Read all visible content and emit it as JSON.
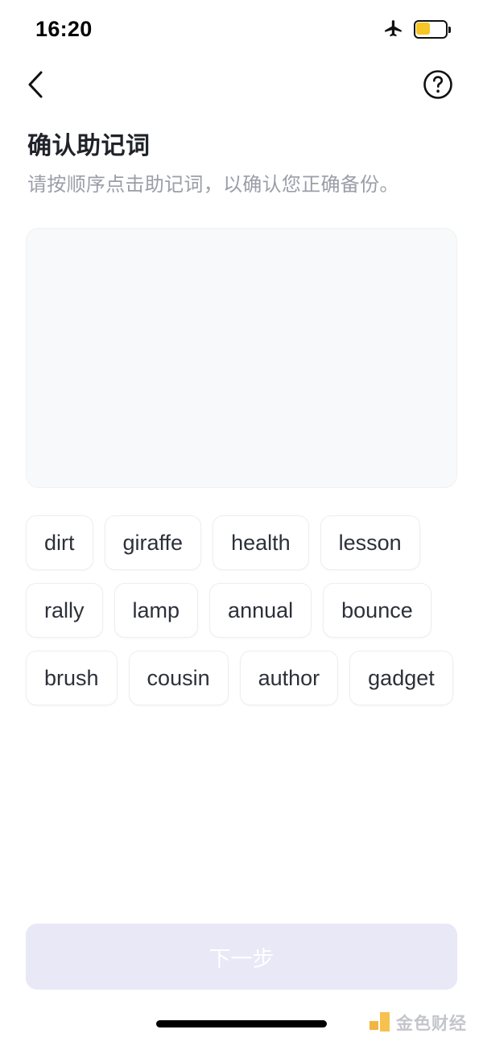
{
  "status_bar": {
    "time": "16:20",
    "airplane_icon": "airplane-mode-icon",
    "battery_icon": "battery-low-power-icon",
    "battery_level_percent": 45,
    "battery_fill_color": "#f6c526"
  },
  "nav": {
    "back_icon": "chevron-left-icon",
    "help_icon": "question-mark-circle-icon"
  },
  "header": {
    "title": "确认助记词",
    "subtitle": "请按顺序点击助记词，以确认您正确备份。"
  },
  "selection_area": {
    "selected_words": [],
    "background_color": "#f8f9fa"
  },
  "word_bank": {
    "words": [
      "dirt",
      "giraffe",
      "health",
      "lesson",
      "rally",
      "lamp",
      "annual",
      "bounce",
      "brush",
      "cousin",
      "author",
      "gadget"
    ]
  },
  "footer": {
    "next_label": "下一步",
    "next_enabled": false,
    "next_background": "#e8e8f6",
    "next_text_color": "#ffffff"
  },
  "watermark": {
    "text": "金色财经",
    "mark_color": "#f5b731"
  }
}
